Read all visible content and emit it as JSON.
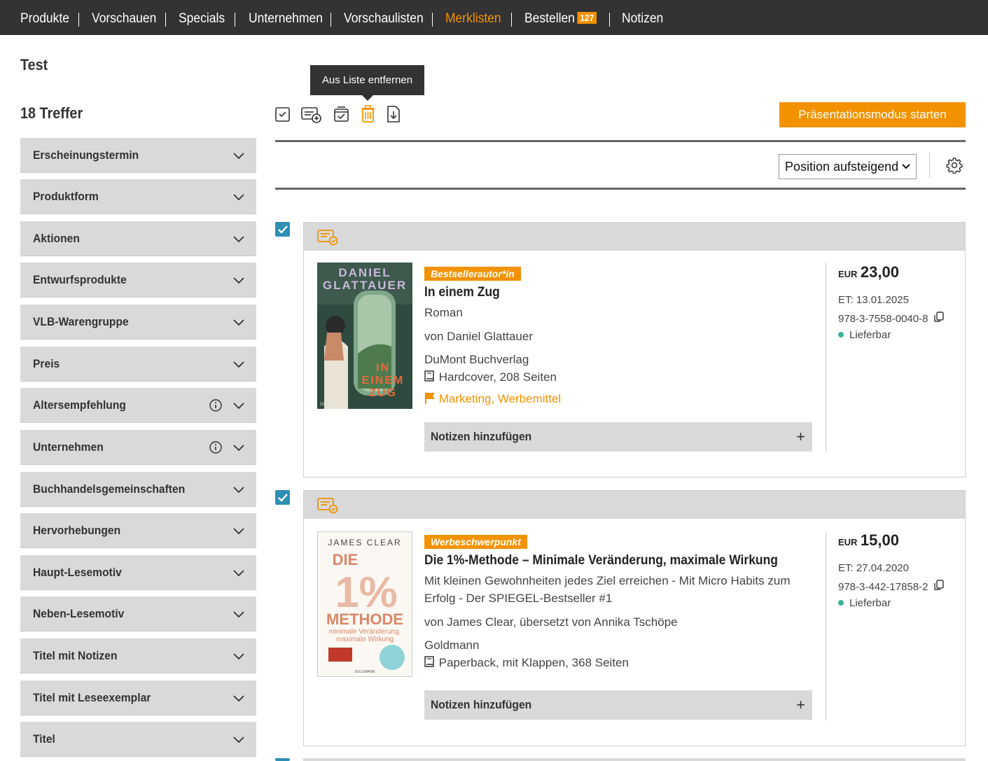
{
  "nav": {
    "items": [
      {
        "label": "Produkte"
      },
      {
        "label": "Vorschauen"
      },
      {
        "label": "Specials"
      },
      {
        "label": "Unternehmen"
      },
      {
        "label": "Vorschaulisten"
      },
      {
        "label": "Merklisten"
      },
      {
        "label": "Bestellen",
        "badge": "127"
      },
      {
        "label": "Notizen"
      }
    ],
    "active_color": "#f39200"
  },
  "list": {
    "title": "Test",
    "hits": "18 Treffer"
  },
  "facets": [
    {
      "label": "Erscheinungstermin"
    },
    {
      "label": "Produktform"
    },
    {
      "label": "Aktionen"
    },
    {
      "label": "Entwurfsprodukte"
    },
    {
      "label": "VLB-Warengruppe"
    },
    {
      "label": "Preis"
    },
    {
      "label": "Altersempfehlung",
      "info": true
    },
    {
      "label": "Unternehmen",
      "info": true
    },
    {
      "label": "Buchhandelsgemeinschaften"
    },
    {
      "label": "Hervorhebungen"
    },
    {
      "label": "Haupt-Lesemotiv"
    },
    {
      "label": "Neben-Lesemotiv"
    },
    {
      "label": "Titel mit Notizen"
    },
    {
      "label": "Titel mit Leseexemplar"
    },
    {
      "label": "Titel"
    }
  ],
  "toolbar": {
    "tooltip": "Aus Liste entfernen",
    "present_label": "Präsentationsmodus starten",
    "icons": [
      "select-all-icon",
      "add-to-list-icon",
      "archive-check-icon",
      "trash-icon",
      "export-download-icon"
    ]
  },
  "sort": {
    "selected": "Position aufsteigend"
  },
  "products": [
    {
      "tag": "Bestsellerautor*in",
      "title": "In einem Zug",
      "subtitle": "Roman",
      "author": "von Daniel Glattauer",
      "publisher": "DuMont Buchverlag",
      "format": "Hardcover, 208 Seiten",
      "links": [
        "Marketing",
        "Werbemittel"
      ],
      "notes_label": "Notizen hinzufügen",
      "currency": "EUR",
      "price": "23,00",
      "et": "ET: 13.01.2025",
      "isbn": "978-3-7558-0040-8",
      "availability": "Lieferbar",
      "cover": {
        "author": "DANIEL GLATTAUER",
        "title": "IN EINEM ZUG",
        "imprint": "DUMONT"
      }
    },
    {
      "tag": "Werbeschwerpunkt",
      "title": "Die 1%-Methode – Minimale Veränderung, maximale Wirkung",
      "subtitle": "Mit kleinen Gewohnheiten jedes Ziel erreichen - Mit Micro Habits zum Erfolg - Der SPIEGEL-Bestseller #1",
      "author": "von James Clear, übersetzt von Annika Tschöpe",
      "publisher": "Goldmann",
      "format": "Paperback, mit Klappen, 368 Seiten",
      "notes_label": "Notizen hinzufügen",
      "currency": "EUR",
      "price": "15,00",
      "et": "ET: 27.04.2020",
      "isbn": "978-3-442-17858-2",
      "availability": "Lieferbar",
      "cover": {
        "author": "JAMES CLEAR",
        "big": "DIE 1%",
        "method": "METHODE",
        "sub": "minimale Veränderung, maximale Wirkung",
        "imprint": "GOLDMANN"
      }
    }
  ]
}
